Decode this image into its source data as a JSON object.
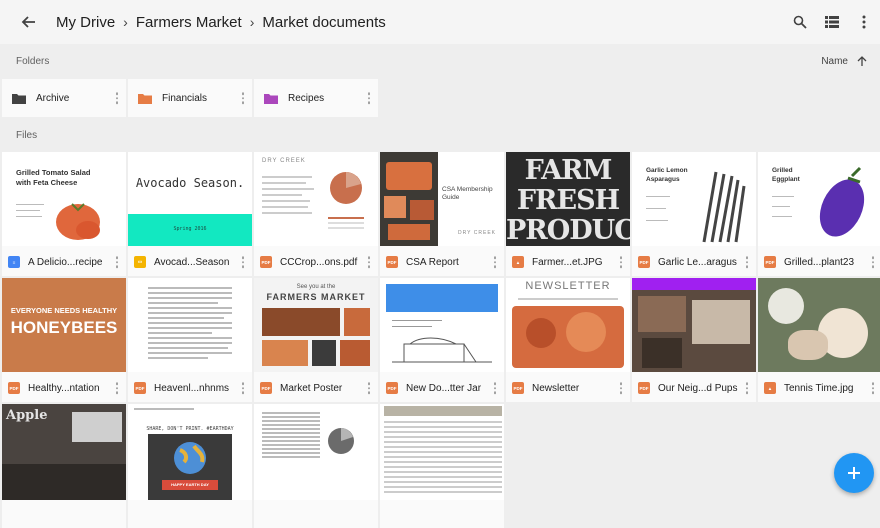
{
  "header": {
    "breadcrumb": [
      "My Drive",
      "Farmers Market",
      "Market documents"
    ]
  },
  "sections": {
    "folders": "Folders",
    "files": "Files"
  },
  "sort": {
    "label": "Name"
  },
  "folders": [
    {
      "name": "Archive",
      "color": "#424242"
    },
    {
      "name": "Financials",
      "color": "#e67c45"
    },
    {
      "name": "Recipes",
      "color": "#ab47bc"
    }
  ],
  "files": [
    {
      "name": "A Delicio...recipe",
      "type": "doc",
      "thumb": {
        "title": "Grilled Tomato Salad with Feta Cheese"
      }
    },
    {
      "name": "Avocad...Season",
      "type": "slides",
      "thumb": {
        "title": "Avocado Season.",
        "subtitle": "Spring 2016"
      }
    },
    {
      "name": "CCCrop...ons.pdf",
      "type": "pdf",
      "thumb": {
        "title": "DRY CREEK"
      }
    },
    {
      "name": "CSA Report",
      "type": "pdf",
      "thumb": {
        "title": "CSA Membership Guide",
        "footer": "DRY CREEK"
      }
    },
    {
      "name": "Farmer...et.JPG",
      "type": "image",
      "thumb": {
        "title": "FARM FRESH PRODUCE"
      }
    },
    {
      "name": "Garlic Le...aragus",
      "type": "pdf",
      "thumb": {
        "title": "Garlic Lemon Asparagus"
      }
    },
    {
      "name": "Grilled...plant23",
      "type": "pdf",
      "thumb": {
        "title": "Grilled Eggplant"
      }
    },
    {
      "name": "Healthy...ntation",
      "type": "pdf",
      "thumb": {
        "title": "EVERYONE NEEDS HEALTHY",
        "subtitle": "HONEYBEES"
      }
    },
    {
      "name": "Heavenl...nhnms",
      "type": "pdf",
      "thumb": {}
    },
    {
      "name": "Market Poster",
      "type": "pdf",
      "thumb": {
        "title": "See you at the",
        "subtitle": "FARMERS MARKET"
      }
    },
    {
      "name": "New Do...tter Jar",
      "type": "pdf",
      "thumb": {}
    },
    {
      "name": "Newsletter",
      "type": "pdf",
      "thumb": {
        "title": "NEWSLETTER"
      }
    },
    {
      "name": "Our Neig...d Pups",
      "type": "pdf",
      "thumb": {}
    },
    {
      "name": "Tennis Time.jpg",
      "type": "image",
      "thumb": {}
    },
    {
      "name": "",
      "type": "image",
      "thumb": {
        "title": "Apple"
      }
    },
    {
      "name": "",
      "type": "pdf",
      "thumb": {
        "title": "SHARE, DON'T PRINT. #EARTHDAY",
        "subtitle": "HAPPY EARTH DAY"
      }
    },
    {
      "name": "",
      "type": "pdf",
      "thumb": {}
    },
    {
      "name": "",
      "type": "pdf",
      "thumb": {}
    }
  ],
  "colors": {
    "doc": "#4285f4",
    "slides": "#f4b400",
    "pdf": "#e67c45",
    "image": "#e67c45",
    "fab": "#2196f3"
  }
}
